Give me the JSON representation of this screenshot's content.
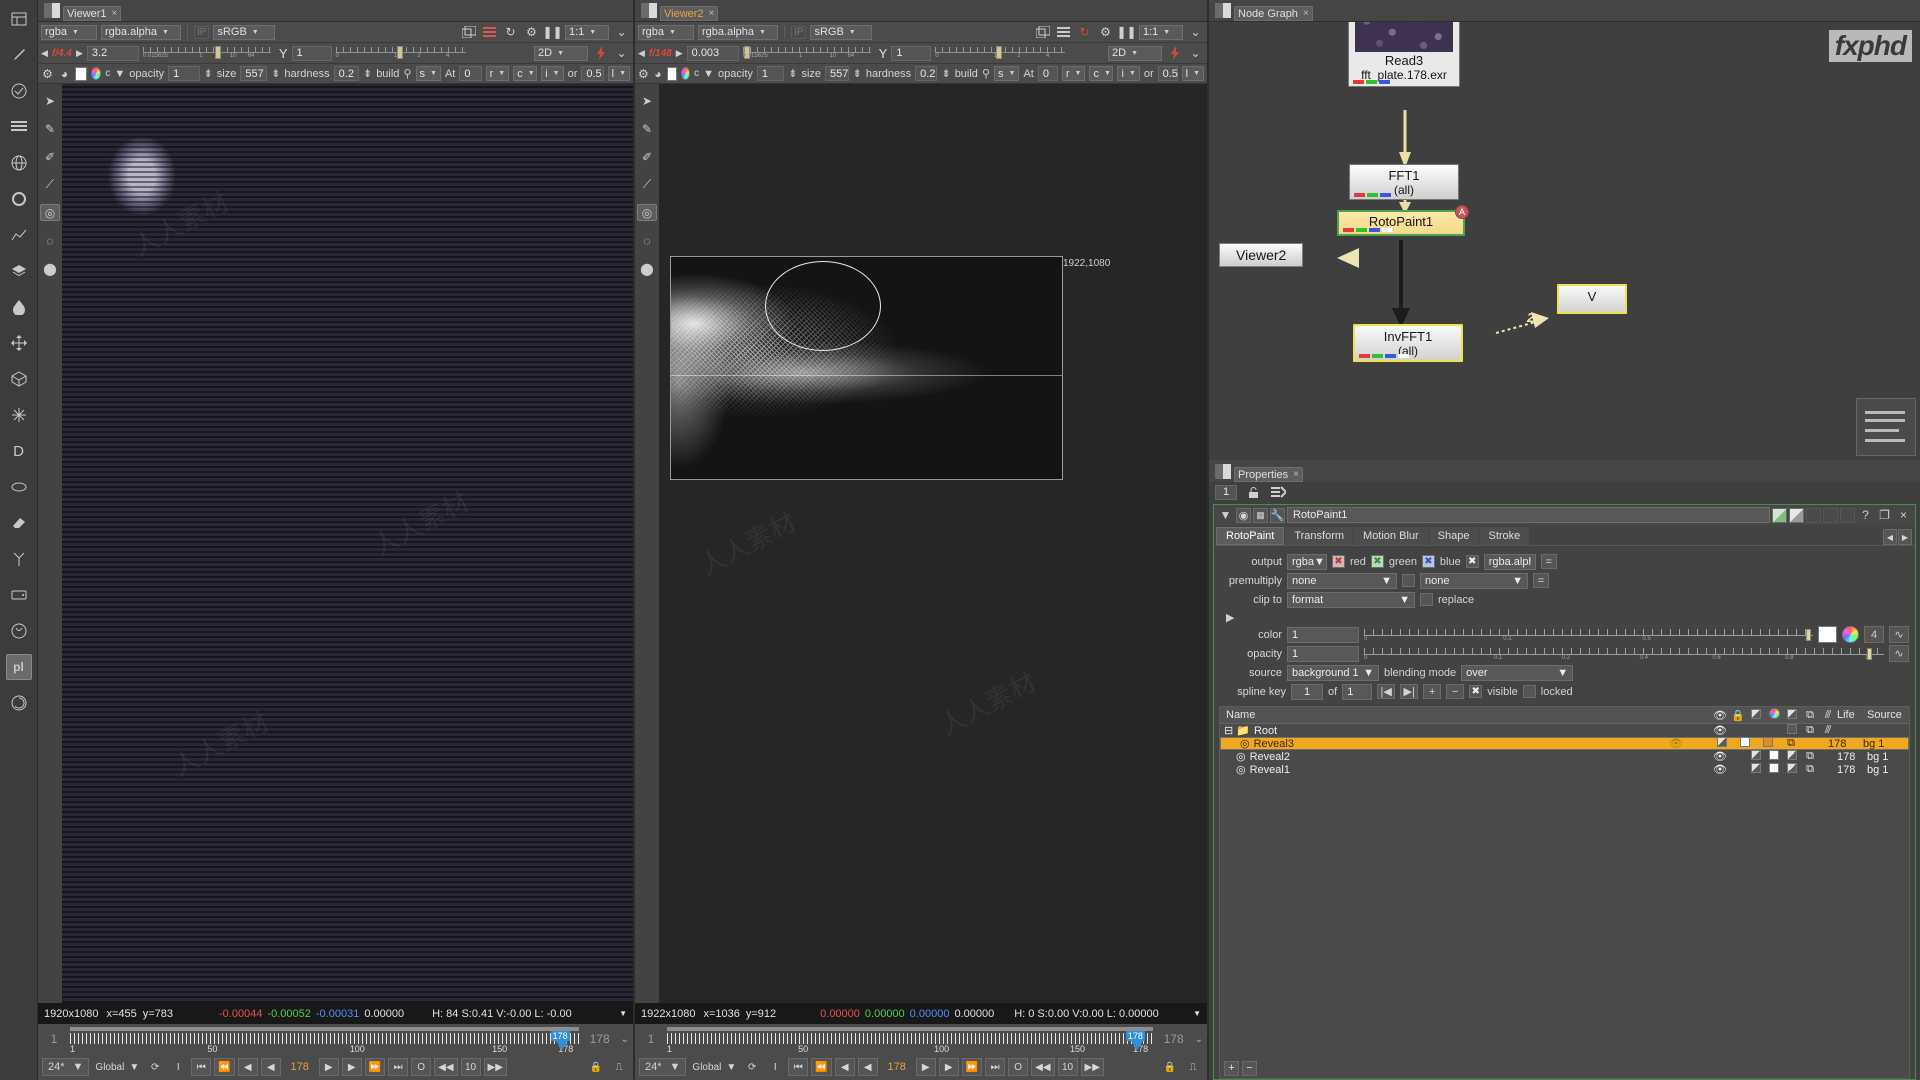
{
  "left_rail": {
    "icons": [
      "panel-icon",
      "pen-icon",
      "check-circle-icon",
      "stack-lines-icon",
      "globe-icon",
      "circle-icon",
      "graph-icon",
      "layers-icon",
      "droplet-icon",
      "move-icon",
      "cube-icon",
      "sparkle-icon",
      "deep-icon",
      "lens-icon",
      "eraser-icon",
      "branch-icon",
      "drive-icon",
      "render-icon",
      "plugin-icon",
      "swirl-icon"
    ],
    "active_icon_label": "pl"
  },
  "viewer1": {
    "tab_label": "Viewer1",
    "close_label": "×",
    "channels": "rgba",
    "channel_layer": "rgba.alpha",
    "ip_label": "IP",
    "colorspace": "sRGB",
    "fstop_label": "f/4.4",
    "gain_value": "3.2",
    "gamma_label": "Y",
    "gamma_value": "1",
    "zoom_label": "1:1",
    "proxy_mode": "2D",
    "gain_ticks": [
      "0.015625",
      "1",
      "10",
      "64"
    ],
    "gamma_ticks": [
      "0",
      "1",
      "2",
      "4"
    ],
    "brush": {
      "opacity_label": "opacity",
      "opacity_value": "1",
      "size_label": "size",
      "size_value": "557",
      "hardness_label": "hardness",
      "hardness_value": "0.2",
      "build_label": "build",
      "s_label": "s",
      "at_label": "At",
      "at_value": "0",
      "r_label": "r",
      "c_label": "c",
      "i_label": "i",
      "or_label": "or",
      "or_value": "0.5",
      "l_label": "l"
    },
    "status": {
      "format": "1920x1080",
      "x": "x=455",
      "y": "y=783",
      "r": "-0.00044",
      "g": "-0.00052",
      "b": "-0.00031",
      "a": "0.00000",
      "hsvl": "H: 84 S:0.41 V:-0.00 L: -0.00"
    },
    "timeline": {
      "start": "1",
      "end": "178",
      "current": "178",
      "playhead_label": "178",
      "ticks": [
        "1",
        "50",
        "100",
        "150",
        "178"
      ],
      "fps": "24*",
      "sync": "Global",
      "increment": "10",
      "zero": "O",
      "in_label": "I"
    }
  },
  "viewer2": {
    "tab_label": "Viewer2",
    "close_label": "×",
    "channels": "rgba",
    "channel_layer": "rgba.alpha",
    "ip_label": "IP",
    "colorspace": "sRGB",
    "fstop_label": "f/148",
    "gain_value": "0.003",
    "gamma_label": "Y",
    "gamma_value": "1",
    "zoom_label": "1:1",
    "proxy_mode": "2D",
    "gain_ticks": [
      "0.015625",
      "1",
      "10",
      "64"
    ],
    "gamma_ticks": [
      "0",
      "1",
      "2",
      "4"
    ],
    "brush": {
      "opacity_label": "opacity",
      "opacity_value": "1",
      "size_label": "size",
      "size_value": "557",
      "hardness_label": "hardness",
      "hardness_value": "0.2",
      "build_label": "build",
      "s_label": "s",
      "at_label": "At",
      "at_value": "0",
      "r_label": "r",
      "c_label": "c",
      "i_label": "i",
      "or_label": "or",
      "or_value": "0.5",
      "l_label": "l"
    },
    "overlay_resolution": "1922,1080",
    "status": {
      "format": "1922x1080",
      "x": "x=1036",
      "y": "y=912",
      "r": "0.00000",
      "g": "0.00000",
      "b": "0.00000",
      "a": "0.00000",
      "hsvl": "H:  0 S:0.00 V:0.00 L: 0.00000"
    },
    "timeline": {
      "start": "1",
      "end": "178",
      "current": "178",
      "playhead_label": "178",
      "ticks": [
        "1",
        "50",
        "100",
        "150",
        "178"
      ],
      "fps": "24*",
      "sync": "Global",
      "increment": "10",
      "zero": "O",
      "in_label": "I"
    }
  },
  "node_graph": {
    "tab_label": "Node Graph",
    "close_label": "×",
    "watermark": "fxphd",
    "nodes": [
      {
        "name": "Read3",
        "sub": "fft_plate.178.exr",
        "type": "read"
      },
      {
        "name": "FFT1",
        "sub": "(all)",
        "type": "plain"
      },
      {
        "name": "RotoPaint1",
        "sub": "",
        "type": "roto",
        "badge": "A"
      },
      {
        "name": "Viewer2",
        "sub": "",
        "type": "viewer"
      },
      {
        "name": "InvFFT1",
        "sub": "(all)",
        "type": "inv"
      },
      {
        "name": "V",
        "sub": "",
        "type": "partial"
      }
    ],
    "connection_label": "2"
  },
  "properties": {
    "tab_label": "Properties",
    "close_label": "×",
    "count": "1",
    "node_name": "RotoPaint1",
    "help_label": "?",
    "float_label": "❐",
    "close_btn": "×",
    "tabs": [
      "RotoPaint",
      "Transform",
      "Motion Blur",
      "Shape",
      "Stroke"
    ],
    "active_tab": "RotoPaint",
    "knobs": {
      "output_label": "output",
      "output_value": "rgba",
      "red_label": "red",
      "green_label": "green",
      "blue_label": "blue",
      "alpha_value": "rgba.alpha",
      "premultiply_label": "premultiply",
      "premultiply_value": "none",
      "premultiply_value2": "none",
      "clip_to_label": "clip to",
      "clip_to_value": "format",
      "replace_label": "replace",
      "color_label": "color",
      "color_value": "1",
      "color_ticks": [
        "0",
        "0.1",
        "0.5",
        "1"
      ],
      "color_channels": "4",
      "opacity_label": "opacity",
      "opacity_value": "1",
      "opacity_ticks": [
        "0",
        "0.1",
        "0.2",
        "0.4",
        "0.6",
        "0.8",
        "1"
      ],
      "source_label": "source",
      "source_value": "background 1",
      "blending_mode_label": "blending mode",
      "blending_mode_value": "over",
      "spline_key_label": "spline key",
      "spline_key_value": "1",
      "of_label": "of",
      "of_value": "1",
      "visible_label": "visible",
      "locked_label": "locked"
    },
    "layer_table": {
      "columns": [
        "Name",
        "eye-icon",
        "lock-icon",
        "mask-icon",
        "color-icon",
        "alpha-icon",
        "blend-icon",
        "motion-icon",
        "Life",
        "Source"
      ],
      "rows": [
        {
          "name": "Root",
          "indent": 0,
          "visible": true,
          "life": "",
          "source": "",
          "selected": false,
          "is_group": true
        },
        {
          "name": "Reveal3",
          "indent": 1,
          "visible": false,
          "life": "178",
          "source": "bg 1",
          "selected": true,
          "is_group": false
        },
        {
          "name": "Reveal2",
          "indent": 1,
          "visible": true,
          "life": "178",
          "source": "bg 1",
          "selected": false,
          "is_group": false
        },
        {
          "name": "Reveal1",
          "indent": 1,
          "visible": true,
          "life": "178",
          "source": "bg 1",
          "selected": false,
          "is_group": false
        }
      ],
      "add_label": "+",
      "remove_label": "−"
    }
  },
  "colors": {
    "selection_orange": "#f0a81e",
    "node_green": "#4fa24f",
    "node_yellow": "#f0e24a",
    "accent_blue": "#2f8fd8",
    "fstop_red": "#d94a3a"
  }
}
